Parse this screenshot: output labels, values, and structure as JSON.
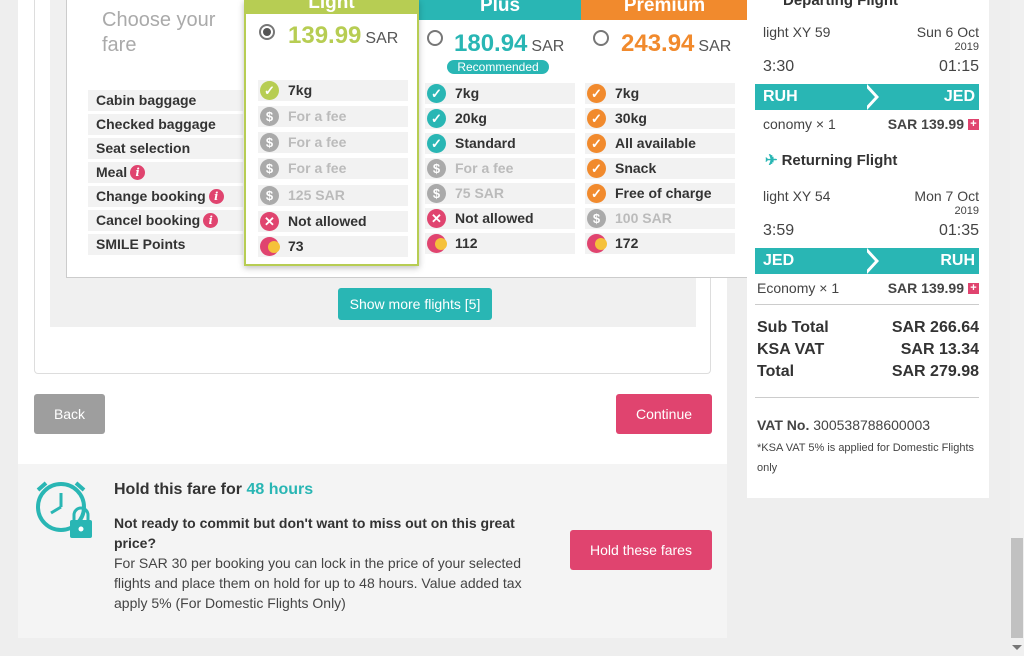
{
  "fares": {
    "choose_label": "Choose your fare",
    "features": [
      {
        "label": "Cabin baggage",
        "info": false
      },
      {
        "label": "Checked baggage",
        "info": false
      },
      {
        "label": "Seat selection",
        "info": false
      },
      {
        "label": "Meal",
        "info": true
      },
      {
        "label": "Change booking",
        "info": true
      },
      {
        "label": "Cancel booking",
        "info": true
      },
      {
        "label": "SMILE Points",
        "info": false
      }
    ],
    "light": {
      "name": "Light",
      "price": "139.99",
      "currency": "SAR",
      "color": "#b7cd53",
      "rows": [
        "7kg",
        "For a fee",
        "For a fee",
        "For a fee",
        "125 SAR",
        "Not allowed",
        "73"
      ]
    },
    "plus": {
      "name": "Plus",
      "price": "180.94",
      "currency": "SAR",
      "color": "#29b6b4",
      "badge": "Recommended",
      "rows": [
        "7kg",
        "20kg",
        "Standard",
        "For a fee",
        "75 SAR",
        "Not allowed",
        "112"
      ]
    },
    "premium": {
      "name": "Premium",
      "price": "243.94",
      "currency": "SAR",
      "color": "#f18a2d",
      "rows": [
        "7kg",
        "30kg",
        "All available",
        "Snack",
        "Free of charge",
        "100 SAR",
        "172"
      ]
    }
  },
  "buttons": {
    "show_more": "Show more flights [5]",
    "back": "Back",
    "continue": "Continue",
    "hold": "Hold these fares"
  },
  "hold": {
    "title_prefix": "Hold this fare for",
    "title_hours": "48 hours",
    "question": "Not ready to commit but don't want to miss out on this great price?",
    "description": "For SAR 30 per booking you can lock in the price of your selected flights and place them on hold for up to 48 hours. Value added tax apply 5% (For Domestic Flights Only)"
  },
  "summary": {
    "departing": {
      "heading": "Departing Flight",
      "flight": "light XY 59",
      "date": "Sun 6 Oct",
      "year": "2019",
      "dep_time": "3:30",
      "arr_time": "01:15",
      "from": "RUH",
      "to": "JED",
      "class": "conomy × 1",
      "price": "SAR 139.99"
    },
    "returning": {
      "heading": "Returning Flight",
      "flight": "light XY 54",
      "date": "Mon 7 Oct",
      "year": "2019",
      "dep_time": "3:59",
      "arr_time": "01:35",
      "from": "JED",
      "to": "RUH",
      "class": "Economy × 1",
      "price": "SAR 139.99"
    },
    "subtotal_label": "Sub Total",
    "subtotal": "SAR 266.64",
    "vat_label": "KSA VAT",
    "vat": "SAR 13.34",
    "total_label": "Total",
    "total": "SAR 279.98",
    "vat_no_label": "VAT No.",
    "vat_no": "300538788600003",
    "vat_note": "*KSA VAT 5% is applied for Domestic Flights only"
  },
  "colors": {
    "accent_teal": "#29b6b4",
    "accent_pink": "#e0446f",
    "light_green": "#b7cd53",
    "premium_orange": "#f18a2d"
  }
}
